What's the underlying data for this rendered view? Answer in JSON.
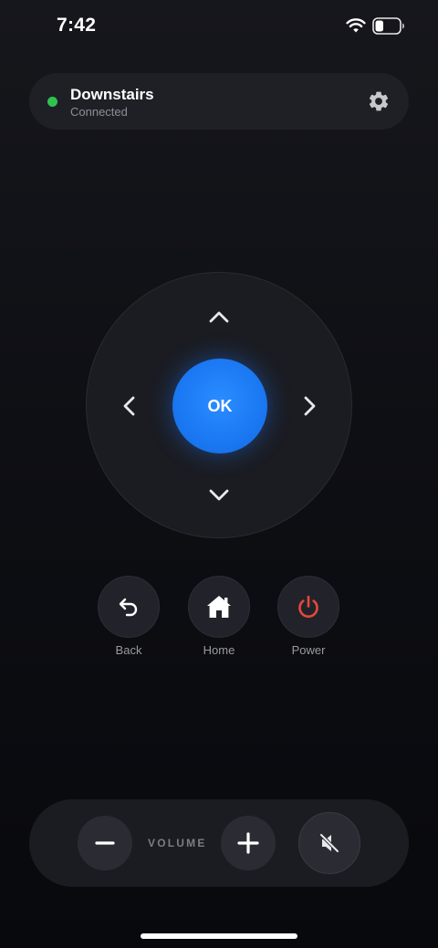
{
  "status_bar": {
    "time": "7:42",
    "wifi_icon": "wifi-icon",
    "battery_icon": "battery-icon"
  },
  "device": {
    "name": "Downstairs",
    "status": "Connected",
    "status_color": "#30c24f",
    "settings_icon": "gear-icon"
  },
  "dpad": {
    "ok_label": "OK",
    "accent_color": "#1a78f2",
    "up_icon": "chevron-up-icon",
    "down_icon": "chevron-down-icon",
    "left_icon": "chevron-left-icon",
    "right_icon": "chevron-right-icon"
  },
  "actions": [
    {
      "label": "Back",
      "icon": "back-arrow-icon"
    },
    {
      "label": "Home",
      "icon": "home-icon"
    },
    {
      "label": "Power",
      "icon": "power-icon",
      "color": "#e5483d"
    }
  ],
  "volume": {
    "label": "VOLUME",
    "minus_icon": "minus-icon",
    "plus_icon": "plus-icon",
    "mute_icon": "speaker-muted-icon"
  }
}
